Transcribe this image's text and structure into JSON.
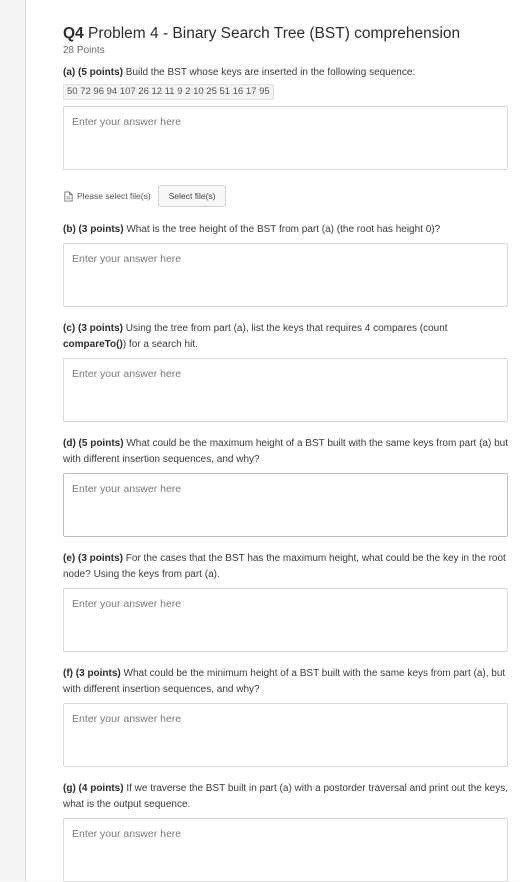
{
  "question": {
    "number": "Q4",
    "title": "Problem 4 - Binary Search Tree (BST) comprehension",
    "points": "28 Points"
  },
  "answer_placeholder": "Enter your answer here",
  "file_upload": {
    "label": "Please select file(s)",
    "button": "Select file(s)"
  },
  "parts": [
    {
      "label": "(a) (5 points)",
      "text": "Build the BST whose keys are inserted in the following sequence:",
      "keys": "50 72 96 94 107 26 12 11 9 2 10 25 51 16 17 95"
    },
    {
      "label": "(b) (3  points)",
      "text": "What is the tree height of the BST from part (a) (the root has height 0)?"
    },
    {
      "label": "(c) (3 points)",
      "text": "Using the tree from part (a), list the keys that requires 4 compares (count",
      "text_bold": "compareTo()",
      "text_after": ") for a search hit."
    },
    {
      "label": "(d) (5 points)",
      "text": "What could be the maximum height of a BST built with the same keys from part (a) but with different insertion sequences, and why?"
    },
    {
      "label": "(e) (3 points)",
      "text": "For the cases that the BST has the maximum height, what could be the key in the root node? Using the keys from part (a)."
    },
    {
      "label": "(f) (3 points)",
      "text": "What could be the minimum height of a BST built with the same keys from part (a), but with different insertion sequences, and why?"
    },
    {
      "label": "(g) (4 points)",
      "text": "If we traverse the BST built in part (a) with a postorder traversal and print out  the keys, what is the output  sequence."
    }
  ]
}
